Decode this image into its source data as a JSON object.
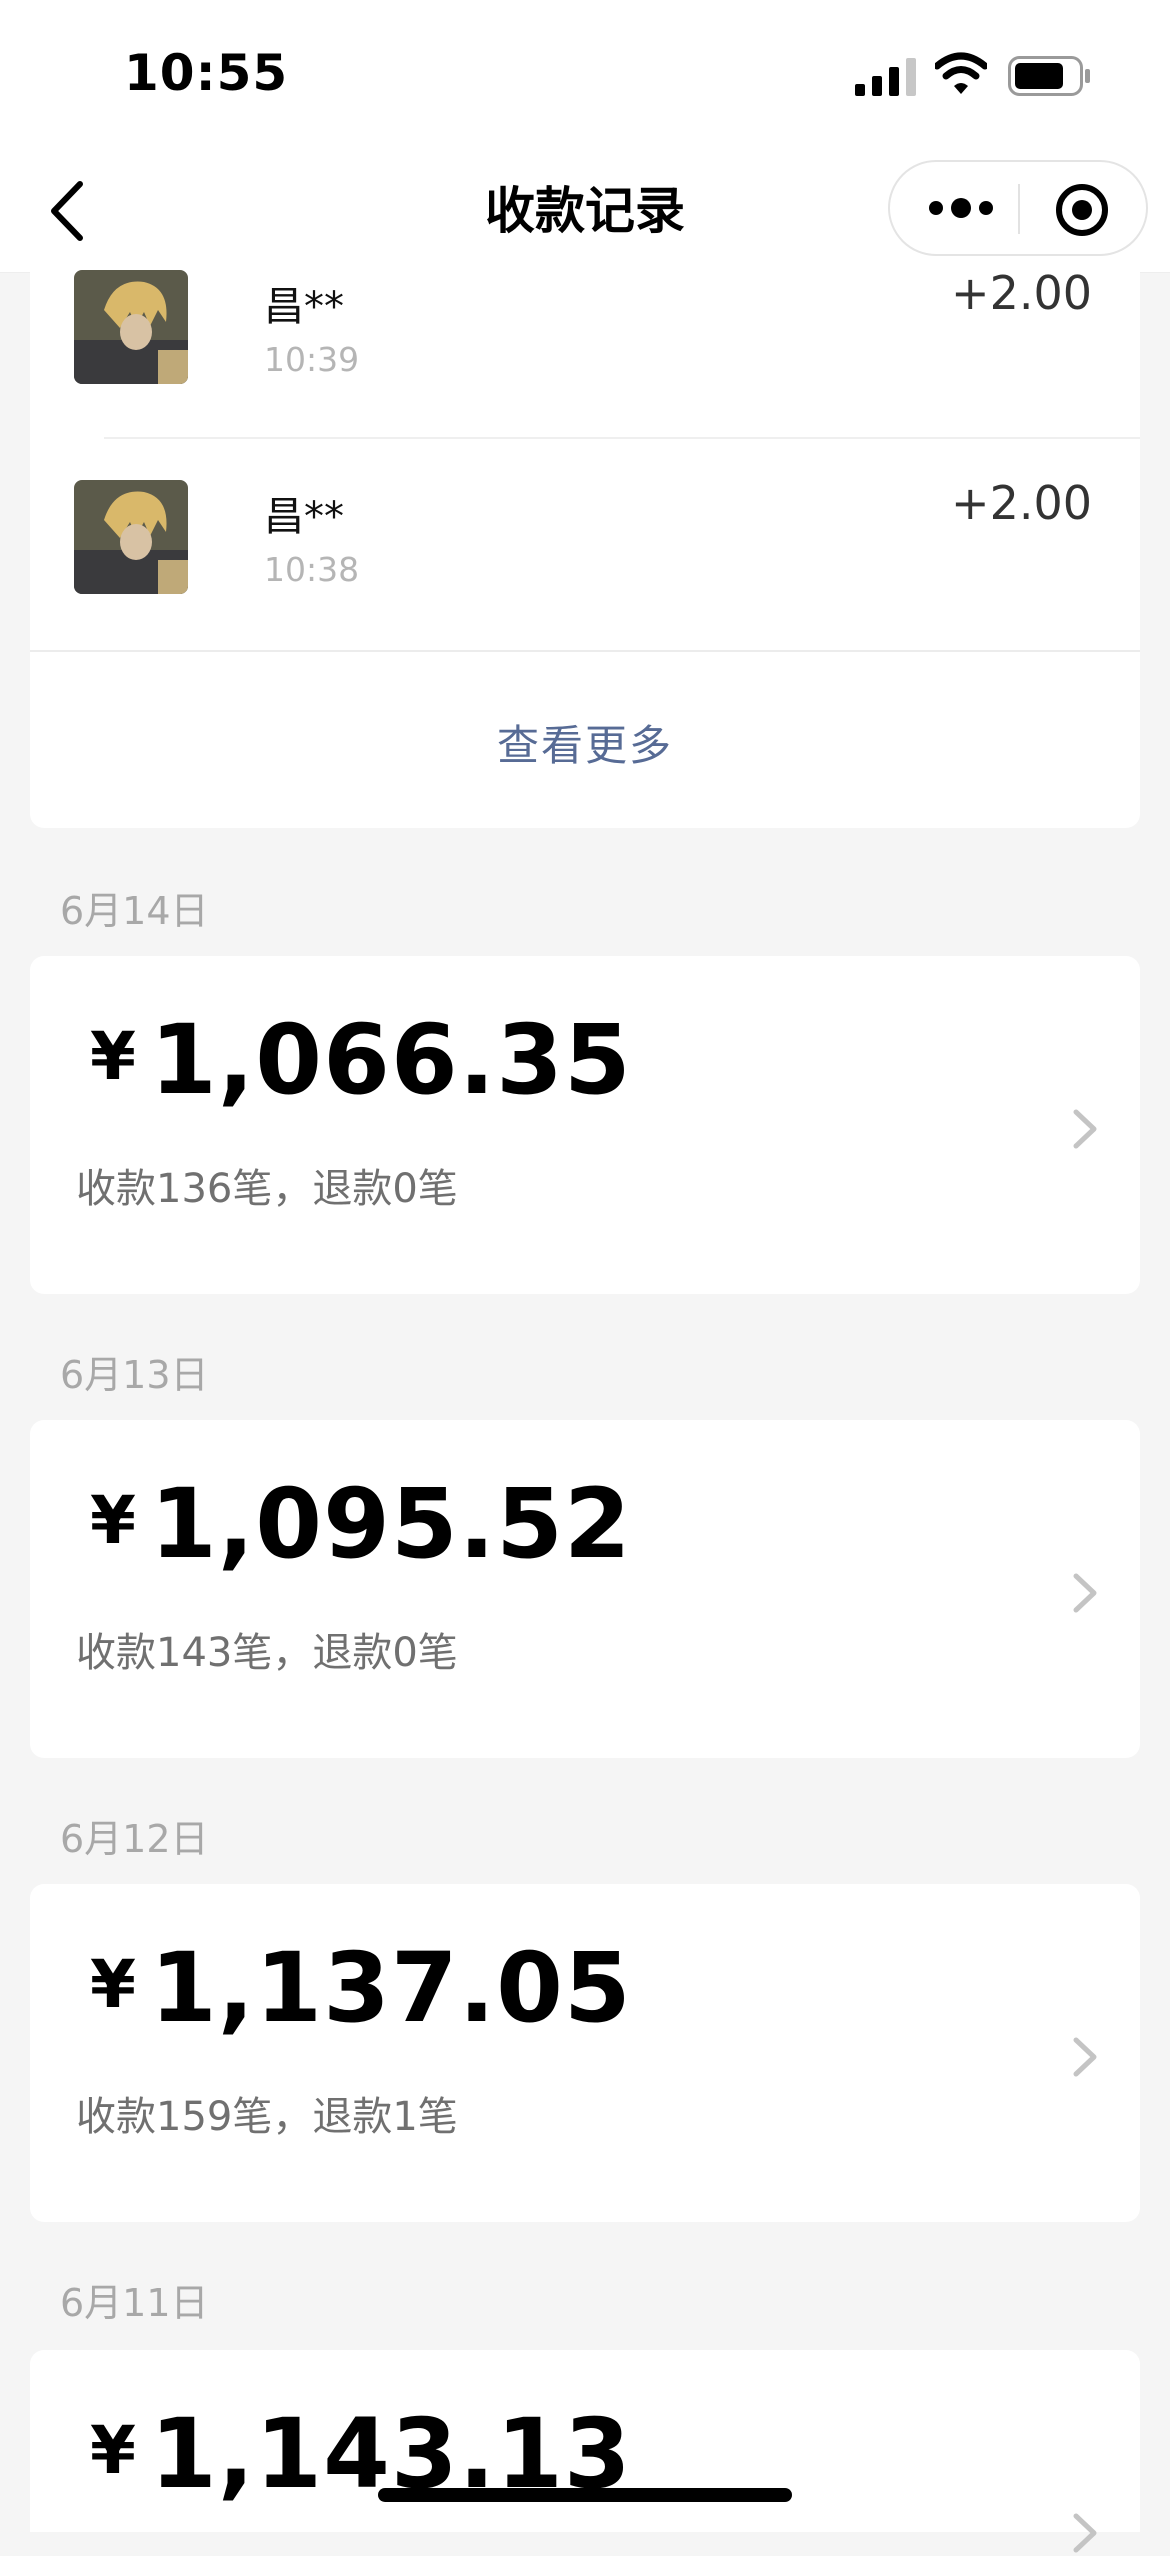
{
  "status_bar": {
    "time": "10:55",
    "icons": [
      "signal-icon",
      "wifi-icon",
      "battery-icon"
    ]
  },
  "nav": {
    "title": "收款记录",
    "icons": [
      "back-arrow-icon",
      "more-dots-icon",
      "target-icon"
    ]
  },
  "transactions": [
    {
      "name": "昌**",
      "time": "10:39",
      "amount": "+2.00"
    },
    {
      "name": "昌**",
      "time": "10:38",
      "amount": "+2.00"
    }
  ],
  "view_more": "查看更多",
  "days": [
    {
      "date": "6月14日",
      "yen": "¥",
      "total": "1,066.35",
      "summary": "收款136笔，退款0笔"
    },
    {
      "date": "6月13日",
      "yen": "¥",
      "total": "1,095.52",
      "summary": "收款143笔，退款0笔"
    },
    {
      "date": "6月12日",
      "yen": "¥",
      "total": "1,137.05",
      "summary": "收款159笔，退款1笔"
    },
    {
      "date": "6月11日",
      "yen": "¥",
      "total": "1,143.13",
      "summary": ""
    }
  ],
  "colors": {
    "link": "#576b95",
    "background": "#f5f5f5",
    "muted": "#a8a8a8"
  }
}
